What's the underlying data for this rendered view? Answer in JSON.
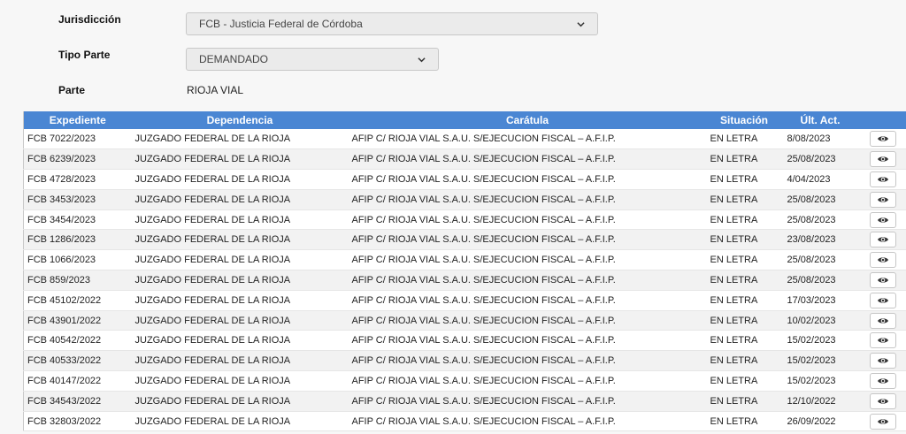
{
  "form": {
    "jurisdiccion_label": "Jurisdicción",
    "jurisdiccion_value": "FCB - Justicia Federal de Córdoba",
    "tipo_parte_label": "Tipo Parte",
    "tipo_parte_value": "DEMANDADO",
    "parte_label": "Parte",
    "parte_value": "RIOJA VIAL"
  },
  "table": {
    "headers": {
      "expediente": "Expediente",
      "dependencia": "Dependencia",
      "caratula": "Carátula",
      "situacion": "Situación",
      "ult_act": "Últ. Act."
    },
    "rows": [
      {
        "expediente": "FCB 7022/2023",
        "dependencia": "JUZGADO FEDERAL DE LA RIOJA",
        "caratula": "AFIP C/ RIOJA VIAL S.A.U. S/EJECUCION FISCAL – A.F.I.P.",
        "situacion": "EN LETRA",
        "ult_act": "8/08/2023"
      },
      {
        "expediente": "FCB 6239/2023",
        "dependencia": "JUZGADO FEDERAL DE LA RIOJA",
        "caratula": "AFIP C/ RIOJA VIAL S.A.U. S/EJECUCION FISCAL – A.F.I.P.",
        "situacion": "EN LETRA",
        "ult_act": "25/08/2023"
      },
      {
        "expediente": "FCB 4728/2023",
        "dependencia": "JUZGADO FEDERAL DE LA RIOJA",
        "caratula": "AFIP C/ RIOJA VIAL S.A.U. S/EJECUCION FISCAL – A.F.I.P.",
        "situacion": "EN LETRA",
        "ult_act": "4/04/2023"
      },
      {
        "expediente": "FCB 3453/2023",
        "dependencia": "JUZGADO FEDERAL DE LA RIOJA",
        "caratula": "AFIP C/ RIOJA VIAL S.A.U. S/EJECUCION FISCAL – A.F.I.P.",
        "situacion": "EN LETRA",
        "ult_act": "25/08/2023"
      },
      {
        "expediente": "FCB 3454/2023",
        "dependencia": "JUZGADO FEDERAL DE LA RIOJA",
        "caratula": "AFIP C/ RIOJA VIAL S.A.U. S/EJECUCION FISCAL – A.F.I.P.",
        "situacion": "EN LETRA",
        "ult_act": "25/08/2023"
      },
      {
        "expediente": "FCB 1286/2023",
        "dependencia": "JUZGADO FEDERAL DE LA RIOJA",
        "caratula": "AFIP C/ RIOJA VIAL S.A.U. S/EJECUCION FISCAL – A.F.I.P.",
        "situacion": "EN LETRA",
        "ult_act": "23/08/2023"
      },
      {
        "expediente": "FCB 1066/2023",
        "dependencia": "JUZGADO FEDERAL DE LA RIOJA",
        "caratula": "AFIP C/ RIOJA VIAL S.A.U. S/EJECUCION FISCAL – A.F.I.P.",
        "situacion": "EN LETRA",
        "ult_act": "25/08/2023"
      },
      {
        "expediente": "FCB 859/2023",
        "dependencia": "JUZGADO FEDERAL DE LA RIOJA",
        "caratula": "AFIP C/ RIOJA VIAL S.A.U. S/EJECUCION FISCAL – A.F.I.P.",
        "situacion": "EN LETRA",
        "ult_act": "25/08/2023"
      },
      {
        "expediente": "FCB 45102/2022",
        "dependencia": "JUZGADO FEDERAL DE LA RIOJA",
        "caratula": "AFIP C/ RIOJA VIAL S.A.U. S/EJECUCION FISCAL – A.F.I.P.",
        "situacion": "EN LETRA",
        "ult_act": "17/03/2023"
      },
      {
        "expediente": "FCB 43901/2022",
        "dependencia": "JUZGADO FEDERAL DE LA RIOJA",
        "caratula": "AFIP C/ RIOJA VIAL S.A.U. S/EJECUCION FISCAL – A.F.I.P.",
        "situacion": "EN LETRA",
        "ult_act": "10/02/2023"
      },
      {
        "expediente": "FCB 40542/2022",
        "dependencia": "JUZGADO FEDERAL DE LA RIOJA",
        "caratula": "AFIP C/ RIOJA VIAL S.A.U. S/EJECUCION FISCAL – A.F.I.P.",
        "situacion": "EN LETRA",
        "ult_act": "15/02/2023"
      },
      {
        "expediente": "FCB 40533/2022",
        "dependencia": "JUZGADO FEDERAL DE LA RIOJA",
        "caratula": "AFIP C/ RIOJA VIAL S.A.U. S/EJECUCION FISCAL – A.F.I.P.",
        "situacion": "EN LETRA",
        "ult_act": "15/02/2023"
      },
      {
        "expediente": "FCB 40147/2022",
        "dependencia": "JUZGADO FEDERAL DE LA RIOJA",
        "caratula": "AFIP C/ RIOJA VIAL S.A.U. S/EJECUCION FISCAL – A.F.I.P.",
        "situacion": "EN LETRA",
        "ult_act": "15/02/2023"
      },
      {
        "expediente": "FCB 34543/2022",
        "dependencia": "JUZGADO FEDERAL DE LA RIOJA",
        "caratula": "AFIP C/ RIOJA VIAL S.A.U. S/EJECUCION FISCAL – A.F.I.P.",
        "situacion": "EN LETRA",
        "ult_act": "12/10/2022"
      },
      {
        "expediente": "FCB 32803/2022",
        "dependencia": "JUZGADO FEDERAL DE LA RIOJA",
        "caratula": "AFIP C/ RIOJA VIAL S.A.U. S/EJECUCION FISCAL – A.F.I.P.",
        "situacion": "EN LETRA",
        "ult_act": "26/09/2022"
      }
    ]
  },
  "icons": {
    "view": "eye-icon",
    "dropdown": "chevron-down-icon"
  },
  "colors": {
    "header_bg": "#4a86d3",
    "header_text": "#ffffff"
  }
}
